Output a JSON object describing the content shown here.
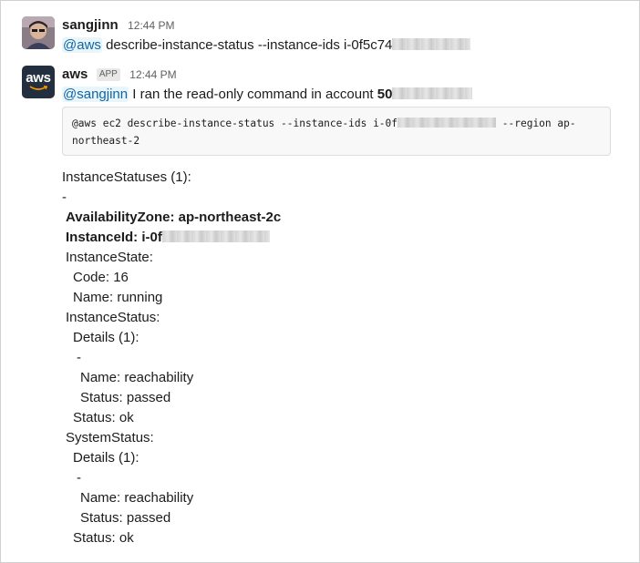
{
  "messages": [
    {
      "sender": "sangjinn",
      "time": "12:44 PM",
      "mention": "@aws",
      "text": "describe-instance-status --instance-ids i-0f5c74"
    },
    {
      "sender": "aws",
      "badge": "APP",
      "time": "12:44 PM",
      "mention": "@sangjinn",
      "text": "I ran the read-only command in account",
      "account_prefix": "50",
      "code": {
        "line1_mention": "@aws",
        "line1_a": "ec2 describe-instance-status --instance-ids i-0f",
        "line1_b": "--region ap-",
        "line2": "northeast-2"
      },
      "output": {
        "heading": "InstanceStatuses (1):",
        "dash": "-",
        "az": "AvailabilityZone: ap-northeast-2c",
        "instance_id": "InstanceId: i-0f",
        "instance_state": "InstanceState:",
        "code": "Code: 16",
        "name": "Name: running",
        "instance_status": "InstanceStatus:",
        "is_details": "Details (1):",
        "is_dash": "-",
        "is_name": "Name: reachability",
        "is_status": "Status: passed",
        "is_overall": "Status: ok",
        "system_status": "SystemStatus:",
        "ss_details": "Details (1):",
        "ss_dash": "-",
        "ss_name": "Name: reachability",
        "ss_status": "Status: passed",
        "ss_overall": "Status: ok"
      }
    }
  ],
  "colors": {
    "mention": "#1264a3",
    "mention_bg": "#e8f5fa",
    "aws_avatar_bg": "#232f3e",
    "aws_smile": "#ff9900"
  }
}
